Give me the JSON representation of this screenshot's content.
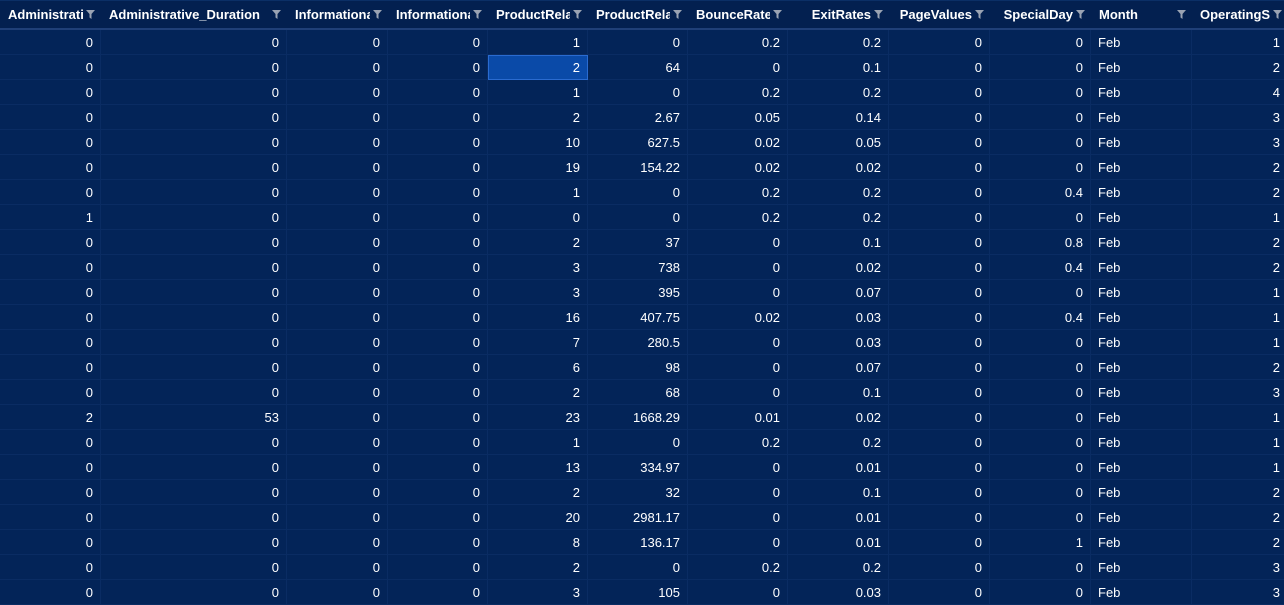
{
  "columns": [
    {
      "label": "Administrative",
      "align": "right"
    },
    {
      "label": "Administrative_Duration",
      "align": "left"
    },
    {
      "label": "Informational",
      "align": "right"
    },
    {
      "label": "Informational_Duration",
      "align": "right"
    },
    {
      "label": "ProductRelated",
      "align": "right"
    },
    {
      "label": "ProductRelated_Duration",
      "align": "right"
    },
    {
      "label": "BounceRates",
      "align": "right"
    },
    {
      "label": "ExitRates",
      "align": "right"
    },
    {
      "label": "PageValues",
      "align": "right"
    },
    {
      "label": "SpecialDay",
      "align": "right"
    },
    {
      "label": "Month",
      "align": "left"
    },
    {
      "label": "OperatingSystems",
      "align": "left"
    }
  ],
  "rows": [
    [
      "0",
      "0",
      "0",
      "0",
      "1",
      "0",
      "0.2",
      "0.2",
      "0",
      "0",
      "Feb",
      "1"
    ],
    [
      "0",
      "0",
      "0",
      "0",
      "2",
      "64",
      "0",
      "0.1",
      "0",
      "0",
      "Feb",
      "2"
    ],
    [
      "0",
      "0",
      "0",
      "0",
      "1",
      "0",
      "0.2",
      "0.2",
      "0",
      "0",
      "Feb",
      "4"
    ],
    [
      "0",
      "0",
      "0",
      "0",
      "2",
      "2.67",
      "0.05",
      "0.14",
      "0",
      "0",
      "Feb",
      "3"
    ],
    [
      "0",
      "0",
      "0",
      "0",
      "10",
      "627.5",
      "0.02",
      "0.05",
      "0",
      "0",
      "Feb",
      "3"
    ],
    [
      "0",
      "0",
      "0",
      "0",
      "19",
      "154.22",
      "0.02",
      "0.02",
      "0",
      "0",
      "Feb",
      "2"
    ],
    [
      "0",
      "0",
      "0",
      "0",
      "1",
      "0",
      "0.2",
      "0.2",
      "0",
      "0.4",
      "Feb",
      "2"
    ],
    [
      "1",
      "0",
      "0",
      "0",
      "0",
      "0",
      "0.2",
      "0.2",
      "0",
      "0",
      "Feb",
      "1"
    ],
    [
      "0",
      "0",
      "0",
      "0",
      "2",
      "37",
      "0",
      "0.1",
      "0",
      "0.8",
      "Feb",
      "2"
    ],
    [
      "0",
      "0",
      "0",
      "0",
      "3",
      "738",
      "0",
      "0.02",
      "0",
      "0.4",
      "Feb",
      "2"
    ],
    [
      "0",
      "0",
      "0",
      "0",
      "3",
      "395",
      "0",
      "0.07",
      "0",
      "0",
      "Feb",
      "1"
    ],
    [
      "0",
      "0",
      "0",
      "0",
      "16",
      "407.75",
      "0.02",
      "0.03",
      "0",
      "0.4",
      "Feb",
      "1"
    ],
    [
      "0",
      "0",
      "0",
      "0",
      "7",
      "280.5",
      "0",
      "0.03",
      "0",
      "0",
      "Feb",
      "1"
    ],
    [
      "0",
      "0",
      "0",
      "0",
      "6",
      "98",
      "0",
      "0.07",
      "0",
      "0",
      "Feb",
      "2"
    ],
    [
      "0",
      "0",
      "0",
      "0",
      "2",
      "68",
      "0",
      "0.1",
      "0",
      "0",
      "Feb",
      "3"
    ],
    [
      "2",
      "53",
      "0",
      "0",
      "23",
      "1668.29",
      "0.01",
      "0.02",
      "0",
      "0",
      "Feb",
      "1"
    ],
    [
      "0",
      "0",
      "0",
      "0",
      "1",
      "0",
      "0.2",
      "0.2",
      "0",
      "0",
      "Feb",
      "1"
    ],
    [
      "0",
      "0",
      "0",
      "0",
      "13",
      "334.97",
      "0",
      "0.01",
      "0",
      "0",
      "Feb",
      "1"
    ],
    [
      "0",
      "0",
      "0",
      "0",
      "2",
      "32",
      "0",
      "0.1",
      "0",
      "0",
      "Feb",
      "2"
    ],
    [
      "0",
      "0",
      "0",
      "0",
      "20",
      "2981.17",
      "0",
      "0.01",
      "0",
      "0",
      "Feb",
      "2"
    ],
    [
      "0",
      "0",
      "0",
      "0",
      "8",
      "136.17",
      "0",
      "0.01",
      "0",
      "1",
      "Feb",
      "2"
    ],
    [
      "0",
      "0",
      "0",
      "0",
      "2",
      "0",
      "0.2",
      "0.2",
      "0",
      "0",
      "Feb",
      "3"
    ],
    [
      "0",
      "0",
      "0",
      "0",
      "3",
      "105",
      "0",
      "0.03",
      "0",
      "0",
      "Feb",
      "3"
    ]
  ],
  "selected_cell": {
    "row": 1,
    "col": 4
  },
  "icons": {
    "filter": "filter-icon"
  },
  "colors": {
    "background": "#032458",
    "header": "#032050",
    "selected": "#0a4aa8",
    "text": "#ffffff"
  }
}
